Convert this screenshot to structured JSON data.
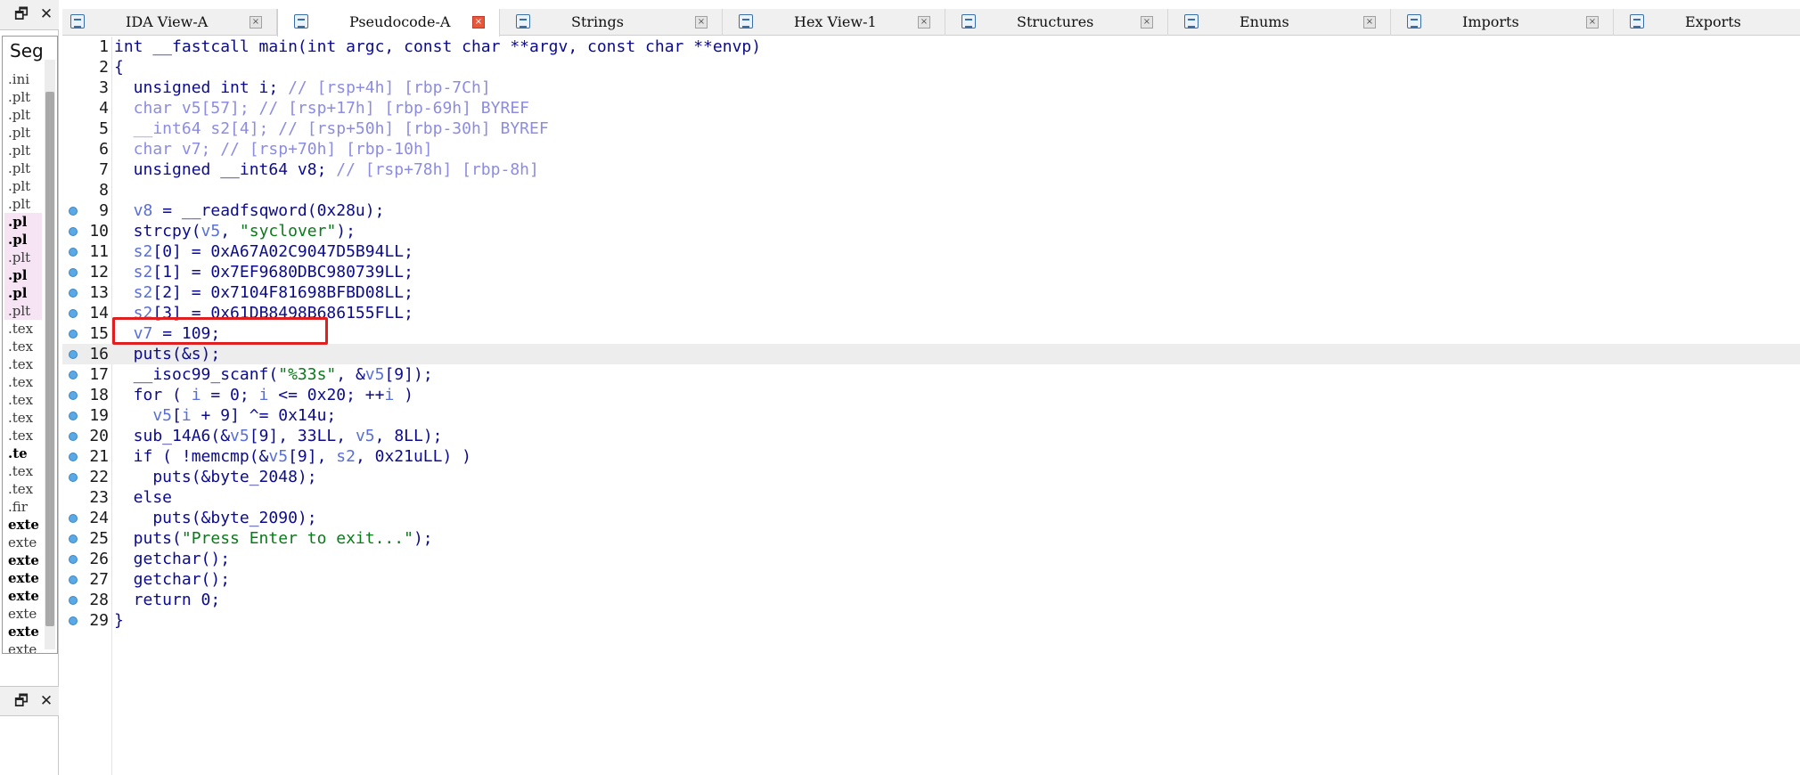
{
  "tabs": [
    {
      "label": "IDA View-A",
      "icon": "disassembly-view-icon",
      "active": false
    },
    {
      "label": "Pseudocode-A",
      "icon": "pseudocode-icon",
      "active": true
    },
    {
      "label": "Strings",
      "icon": "strings-icon",
      "active": false
    },
    {
      "label": "Hex View-1",
      "icon": "hex-view-icon",
      "active": false
    },
    {
      "label": "Structures",
      "icon": "structures-icon",
      "active": false
    },
    {
      "label": "Enums",
      "icon": "enums-icon",
      "active": false
    },
    {
      "label": "Imports",
      "icon": "imports-icon",
      "active": false
    },
    {
      "label": "Exports",
      "icon": "exports-icon",
      "active": false
    }
  ],
  "left_panel": {
    "restore_glyph": "🗗",
    "close_glyph": "✕",
    "segments_title": "Seg",
    "segments": [
      {
        "label": ".ini",
        "pink": false,
        "bold": false
      },
      {
        "label": ".plt",
        "pink": false,
        "bold": false
      },
      {
        "label": ".plt",
        "pink": false,
        "bold": false
      },
      {
        "label": ".plt",
        "pink": false,
        "bold": false
      },
      {
        "label": ".plt",
        "pink": false,
        "bold": false
      },
      {
        "label": ".plt",
        "pink": false,
        "bold": false
      },
      {
        "label": ".plt",
        "pink": false,
        "bold": false
      },
      {
        "label": ".plt",
        "pink": false,
        "bold": false
      },
      {
        "label": ".pl",
        "pink": true,
        "bold": true
      },
      {
        "label": ".pl",
        "pink": true,
        "bold": true
      },
      {
        "label": ".plt",
        "pink": true,
        "bold": false
      },
      {
        "label": ".pl",
        "pink": true,
        "bold": true
      },
      {
        "label": ".pl",
        "pink": true,
        "bold": true
      },
      {
        "label": ".plt",
        "pink": true,
        "bold": false
      },
      {
        "label": ".tex",
        "pink": false,
        "bold": false
      },
      {
        "label": ".tex",
        "pink": false,
        "bold": false
      },
      {
        "label": ".tex",
        "pink": false,
        "bold": false
      },
      {
        "label": ".tex",
        "pink": false,
        "bold": false
      },
      {
        "label": ".tex",
        "pink": false,
        "bold": false
      },
      {
        "label": ".tex",
        "pink": false,
        "bold": false
      },
      {
        "label": ".tex",
        "pink": false,
        "bold": false
      },
      {
        "label": ".te",
        "pink": false,
        "bold": true
      },
      {
        "label": ".tex",
        "pink": false,
        "bold": false
      },
      {
        "label": ".tex",
        "pink": false,
        "bold": false
      },
      {
        "label": ".fir",
        "pink": false,
        "bold": false
      },
      {
        "label": "exte",
        "pink": false,
        "bold": true
      },
      {
        "label": "exte",
        "pink": false,
        "bold": false
      },
      {
        "label": "exte",
        "pink": false,
        "bold": true
      },
      {
        "label": "exte",
        "pink": false,
        "bold": true
      },
      {
        "label": "exte",
        "pink": false,
        "bold": true
      },
      {
        "label": "exte",
        "pink": false,
        "bold": false
      },
      {
        "label": "exte",
        "pink": false,
        "bold": true
      },
      {
        "label": "exte",
        "pink": false,
        "bold": false
      }
    ]
  },
  "code": {
    "current_line": 16,
    "highlight_line": 15,
    "lines": [
      {
        "n": "1",
        "bp": false,
        "tokens": [
          [
            "p",
            "int __fastcall main(int argc, const char **argv, const char **envp)"
          ]
        ]
      },
      {
        "n": "2",
        "bp": false,
        "tokens": [
          [
            "p",
            "{"
          ]
        ]
      },
      {
        "n": "3",
        "bp": false,
        "tokens": [
          [
            "p",
            "  unsigned int i; "
          ],
          [
            "c",
            "// [rsp+4h] [rbp-7Ch]"
          ]
        ]
      },
      {
        "n": "4",
        "bp": false,
        "tokens": [
          [
            "c",
            "  char v5[57]; // [rsp+17h] [rbp-69h] BYREF"
          ]
        ]
      },
      {
        "n": "5",
        "bp": false,
        "tokens": [
          [
            "c",
            "  __int64 s2[4]; // [rsp+50h] [rbp-30h] BYREF"
          ]
        ]
      },
      {
        "n": "6",
        "bp": false,
        "tokens": [
          [
            "c",
            "  char v7; // [rsp+70h] [rbp-10h]"
          ]
        ]
      },
      {
        "n": "7",
        "bp": false,
        "tokens": [
          [
            "p",
            "  unsigned __int64 v8; "
          ],
          [
            "c",
            "// [rsp+78h] [rbp-8h]"
          ]
        ]
      },
      {
        "n": "8",
        "bp": false,
        "tokens": [
          [
            "p",
            ""
          ]
        ]
      },
      {
        "n": "9",
        "bp": true,
        "tokens": [
          [
            "v",
            "  v8"
          ],
          [
            "p",
            " = __readfsqword(0x28u);"
          ]
        ]
      },
      {
        "n": "10",
        "bp": true,
        "tokens": [
          [
            "p",
            "  strcpy("
          ],
          [
            "v",
            "v5"
          ],
          [
            "p",
            ", "
          ],
          [
            "s",
            "\"syclover\""
          ],
          [
            "p",
            ");"
          ]
        ]
      },
      {
        "n": "11",
        "bp": true,
        "tokens": [
          [
            "v",
            "  s2"
          ],
          [
            "p",
            "[0] = 0xA67A02C9047D5B94LL;"
          ]
        ]
      },
      {
        "n": "12",
        "bp": true,
        "tokens": [
          [
            "v",
            "  s2"
          ],
          [
            "p",
            "[1] = 0x7EF9680DBC980739LL;"
          ]
        ]
      },
      {
        "n": "13",
        "bp": true,
        "tokens": [
          [
            "v",
            "  s2"
          ],
          [
            "p",
            "[2] = 0x7104F81698BFBD08LL;"
          ]
        ]
      },
      {
        "n": "14",
        "bp": true,
        "tokens": [
          [
            "v",
            "  s2"
          ],
          [
            "p",
            "[3] = 0x61DB8498B686155FLL;"
          ]
        ]
      },
      {
        "n": "15",
        "bp": true,
        "tokens": [
          [
            "v",
            "  v7"
          ],
          [
            "p",
            " = 109;"
          ]
        ]
      },
      {
        "n": "16",
        "bp": true,
        "tokens": [
          [
            "p",
            "  puts(&s);"
          ]
        ]
      },
      {
        "n": "17",
        "bp": true,
        "tokens": [
          [
            "p",
            "  __isoc99_scanf("
          ],
          [
            "s",
            "\"%33s\""
          ],
          [
            "p",
            ", &"
          ],
          [
            "v",
            "v5"
          ],
          [
            "p",
            "[9]);"
          ]
        ]
      },
      {
        "n": "18",
        "bp": true,
        "tokens": [
          [
            "p",
            "  for ( "
          ],
          [
            "v",
            "i"
          ],
          [
            "p",
            " = 0; "
          ],
          [
            "v",
            "i"
          ],
          [
            "p",
            " <= 0x20; ++"
          ],
          [
            "v",
            "i"
          ],
          [
            "p",
            " )"
          ]
        ]
      },
      {
        "n": "19",
        "bp": true,
        "tokens": [
          [
            "v",
            "    v5"
          ],
          [
            "p",
            "["
          ],
          [
            "v",
            "i"
          ],
          [
            "p",
            " + 9] ^= 0x14u;"
          ]
        ]
      },
      {
        "n": "20",
        "bp": true,
        "tokens": [
          [
            "p",
            "  sub_14A6(&"
          ],
          [
            "v",
            "v5"
          ],
          [
            "p",
            "[9], 33LL, "
          ],
          [
            "v",
            "v5"
          ],
          [
            "p",
            ", 8LL);"
          ]
        ]
      },
      {
        "n": "21",
        "bp": true,
        "tokens": [
          [
            "p",
            "  if ( !memcmp(&"
          ],
          [
            "v",
            "v5"
          ],
          [
            "p",
            "[9], "
          ],
          [
            "v",
            "s2"
          ],
          [
            "p",
            ", 0x21uLL) )"
          ]
        ]
      },
      {
        "n": "22",
        "bp": true,
        "tokens": [
          [
            "p",
            "    puts(&byte_2048);"
          ]
        ]
      },
      {
        "n": "23",
        "bp": false,
        "tokens": [
          [
            "p",
            "  else"
          ]
        ]
      },
      {
        "n": "24",
        "bp": true,
        "tokens": [
          [
            "p",
            "    puts(&byte_2090);"
          ]
        ]
      },
      {
        "n": "25",
        "bp": true,
        "tokens": [
          [
            "p",
            "  puts("
          ],
          [
            "s",
            "\"Press Enter to exit...\""
          ],
          [
            "p",
            ");"
          ]
        ]
      },
      {
        "n": "26",
        "bp": true,
        "tokens": [
          [
            "p",
            "  getchar();"
          ]
        ]
      },
      {
        "n": "27",
        "bp": true,
        "tokens": [
          [
            "p",
            "  getchar();"
          ]
        ]
      },
      {
        "n": "28",
        "bp": true,
        "tokens": [
          [
            "p",
            "  return 0;"
          ]
        ]
      },
      {
        "n": "29",
        "bp": true,
        "tokens": [
          [
            "p",
            "}"
          ]
        ]
      }
    ]
  }
}
